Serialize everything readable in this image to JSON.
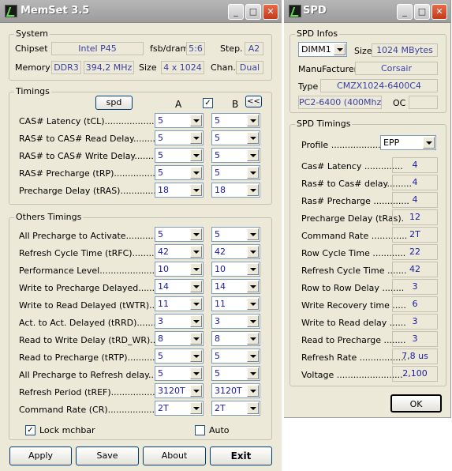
{
  "memset": {
    "title": "MemSet 3.5",
    "system": {
      "group_label": "System",
      "chipset_label": "Chipset",
      "chipset": "Intel P45",
      "fsb_label": "fsb/dram",
      "fsb": "5:6",
      "step_label": "Step.",
      "step": "A2",
      "memory_label": "Memory",
      "mem_type": "DDR3",
      "mem_freq": "394,2 MHz",
      "size_label": "Size",
      "size": "4 x 1024",
      "chan_label": "Chan.",
      "chan": "Dual"
    },
    "timings": {
      "group_label": "Timings",
      "spd_button": "spd",
      "col_a": "A",
      "col_b": "B",
      "link_button": "<<",
      "rows": [
        {
          "label": "CAS# Latency (tCL)..........................",
          "a": "5",
          "b": "5"
        },
        {
          "label": "RAS# to CAS# Read Delay...........",
          "a": "5",
          "b": "5"
        },
        {
          "label": "RAS# to CAS# Write Delay..........",
          "a": "5",
          "b": "5"
        },
        {
          "label": "RAS# Precharge (tRP)......................",
          "a": "5",
          "b": "5"
        },
        {
          "label": "Precharge Delay  (tRAS)..................",
          "a": "18",
          "b": "18"
        }
      ]
    },
    "others": {
      "group_label": "Others Timings",
      "rows": [
        {
          "label": "All Precharge to Activate...................",
          "a": "5",
          "b": "5"
        },
        {
          "label": "Refresh Cycle Time (tRFC)..................",
          "a": "42",
          "b": "42"
        },
        {
          "label": "Performance Level..............................",
          "a": "10",
          "b": "10"
        },
        {
          "label": "Write to Precharge Delayed.................",
          "a": "14",
          "b": "14"
        },
        {
          "label": "Write to Read Delayed (tWTR)...............",
          "a": "11",
          "b": "11"
        },
        {
          "label": "Act. to Act. Delayed (tRRD)...................",
          "a": "3",
          "b": "3"
        },
        {
          "label": "Read to Write Delay (tRD_WR)...........",
          "a": "8",
          "b": "8"
        },
        {
          "label": "Read to Precharge (tRTP)...................",
          "a": "5",
          "b": "5"
        },
        {
          "label": "All Precharge to Refresh delay...........",
          "a": "5",
          "b": "5"
        },
        {
          "label": "Refresh Period (tREF).........................",
          "a": "3120T",
          "b": "3120T"
        },
        {
          "label": "Command Rate (CR)...........................",
          "a": "2T",
          "b": "2T"
        }
      ],
      "lock_label": "Lock mchbar",
      "lock_checked": "✓",
      "auto_label": "Auto"
    },
    "buttons": {
      "apply": "Apply",
      "save": "Save",
      "about": "About",
      "exit": "Exit"
    }
  },
  "spd": {
    "title": "SPD",
    "infos": {
      "group_label": "SPD Infos",
      "dimm": "DIMM1",
      "size_label": "Size",
      "size": "1024 MBytes",
      "manuf_label": "ManuFacturer",
      "manuf": "Corsair",
      "type_label": "Type",
      "type": "CMZX1024-6400C4",
      "module": "PC2-6400 (400Mhz)",
      "oc_label": "OC",
      "oc": ""
    },
    "timings": {
      "group_label": "SPD Timings",
      "profile_label": "Profile .........................",
      "profile": "EPP",
      "rows": [
        {
          "label": "Cas# Latency ..............",
          "value": "4"
        },
        {
          "label": "Ras# to Cas# delay.........",
          "value": "4"
        },
        {
          "label": "Ras# Precharge .............",
          "value": "4"
        },
        {
          "label": "Precharge Delay (tRas).",
          "value": "12"
        },
        {
          "label": "Command Rate .............",
          "value": "2T"
        },
        {
          "label": "Row Cycle Time ............",
          "value": "22"
        },
        {
          "label": "Refresh Cycle Time .......",
          "value": "42"
        },
        {
          "label": "Row to Row Delay ........",
          "value": "3"
        },
        {
          "label": "Write Recovery time .....",
          "value": "6"
        },
        {
          "label": "Write to Read delay ......",
          "value": "3"
        },
        {
          "label": "Read to Precharge ........",
          "value": "3"
        },
        {
          "label": "Refresh Rate .................",
          "value": "7,8 us"
        },
        {
          "label": "Voltage ........................",
          "value": "2,100"
        }
      ]
    },
    "ok": "OK"
  }
}
